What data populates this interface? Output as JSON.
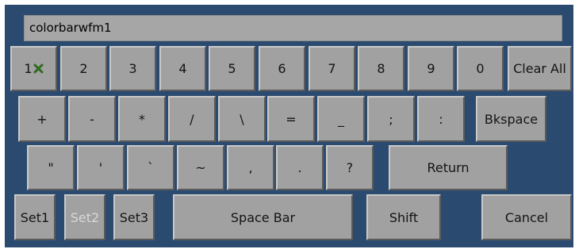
{
  "input": {
    "value": "colorbarwfm1"
  },
  "keys": {
    "k1": "1",
    "k2": "2",
    "k3": "3",
    "k4": "4",
    "k5": "5",
    "k6": "6",
    "k7": "7",
    "k8": "8",
    "k9": "9",
    "k0": "0",
    "clear_all": "Clear All",
    "plus": "+",
    "minus": "-",
    "asterisk": "*",
    "slash": "/",
    "backslash": "\\",
    "equals": "=",
    "underscore": "_",
    "semicolon": ";",
    "colon": ":",
    "bkspace": "Bkspace",
    "dquote": "\"",
    "squote": "'",
    "backtick": "`",
    "tilde": "~",
    "comma": ",",
    "period": ".",
    "question": "?",
    "return": "Return",
    "set1": "Set1",
    "set2": "Set2",
    "set3": "Set3",
    "space_bar": "Space Bar",
    "shift": "Shift",
    "cancel": "Cancel"
  },
  "states": {
    "set2_disabled": true
  },
  "colors": {
    "panel_bg": "#2b4a6f",
    "key_bg": "#a1a1a1",
    "disabled_text": "#d8d8d8",
    "cursor_icon": "#2f6b1e"
  },
  "icons": {
    "on_key_1": "x-cursor-icon"
  }
}
